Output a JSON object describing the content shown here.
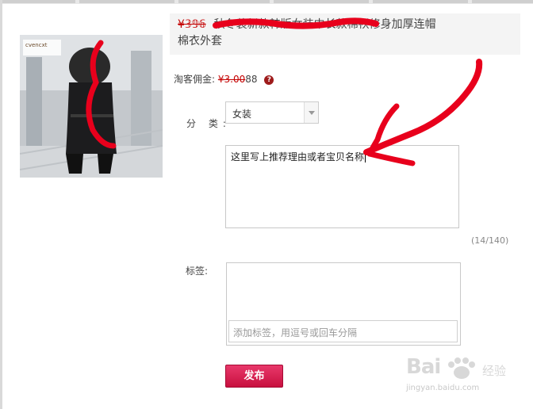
{
  "product": {
    "price": "¥𝟛𝟡𝟞",
    "title_line1": "秋冬装新款韩版女装中长款棉袄修身加厚连帽",
    "title_line2": "棉衣外套",
    "image_brand_text": "cvencxt"
  },
  "commission": {
    "label": "淘客佣金:",
    "masked_value": "¥3.00",
    "value_suffix": "88",
    "help_icon": "?"
  },
  "category": {
    "label": "分 类:",
    "selected": "女装"
  },
  "reason": {
    "text": "这里写上推荐理由或者宝贝名称",
    "counter": "(14/140)"
  },
  "tags": {
    "label": "标签:",
    "placeholder": "添加标签，用逗号或回车分隔"
  },
  "actions": {
    "publish_label": "发布"
  },
  "watermark": {
    "brand": "Bai",
    "sub": "经验",
    "url": "jingyan.baidu.com"
  },
  "colors": {
    "accent": "#d0144a",
    "annotation": "#e8001c"
  }
}
